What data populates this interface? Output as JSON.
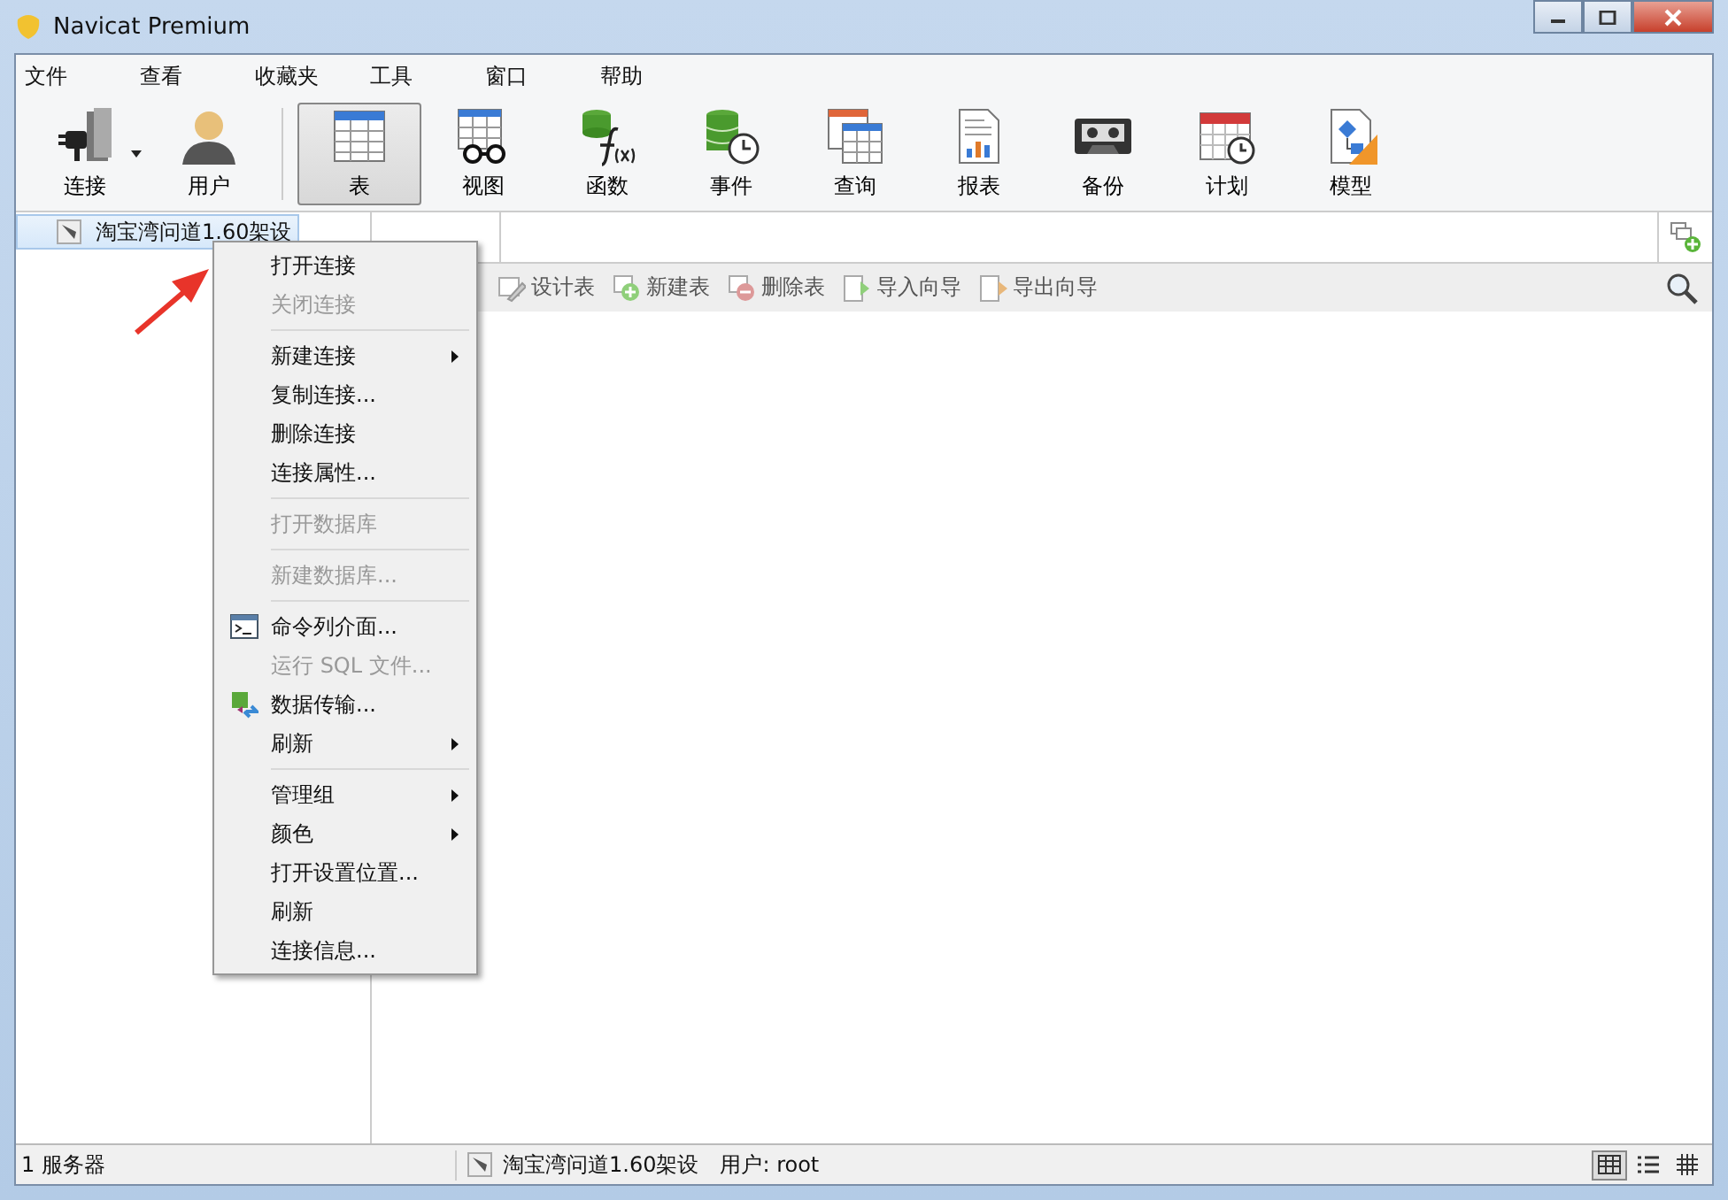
{
  "window": {
    "title": "Navicat Premium"
  },
  "menu_bar": [
    "文件",
    "查看",
    "收藏夹",
    "工具",
    "窗口",
    "帮助"
  ],
  "toolbar": [
    {
      "label": "连接",
      "kind": "connection",
      "dropdown": true,
      "selected": false
    },
    {
      "label": "用户",
      "kind": "user",
      "dropdown": false,
      "selected": false
    },
    {
      "label": "表",
      "kind": "table",
      "dropdown": false,
      "selected": true
    },
    {
      "label": "视图",
      "kind": "view",
      "dropdown": false,
      "selected": false
    },
    {
      "label": "函数",
      "kind": "function",
      "dropdown": false,
      "selected": false
    },
    {
      "label": "事件",
      "kind": "event",
      "dropdown": false,
      "selected": false
    },
    {
      "label": "查询",
      "kind": "query",
      "dropdown": false,
      "selected": false
    },
    {
      "label": "报表",
      "kind": "report",
      "dropdown": false,
      "selected": false
    },
    {
      "label": "备份",
      "kind": "backup",
      "dropdown": false,
      "selected": false
    },
    {
      "label": "计划",
      "kind": "schedule",
      "dropdown": false,
      "selected": false
    },
    {
      "label": "模型",
      "kind": "model",
      "dropdown": false,
      "selected": false
    }
  ],
  "tree": {
    "items": [
      {
        "label": "淘宝湾问道1.60架设",
        "selected": true
      }
    ]
  },
  "object_toolbar": [
    {
      "label": "设计表",
      "kind": "design"
    },
    {
      "label": "新建表",
      "kind": "new"
    },
    {
      "label": "删除表",
      "kind": "delete"
    },
    {
      "label": "导入向导",
      "kind": "import"
    },
    {
      "label": "导出向导",
      "kind": "export"
    }
  ],
  "context_menu": [
    {
      "kind": "plain",
      "label": "打开连接",
      "disabled": false,
      "submenu": false
    },
    {
      "kind": "plain",
      "label": "关闭连接",
      "disabled": true,
      "submenu": false
    },
    {
      "kind": "separator"
    },
    {
      "kind": "plain",
      "label": "新建连接",
      "disabled": false,
      "submenu": true
    },
    {
      "kind": "plain",
      "label": "复制连接...",
      "disabled": false,
      "submenu": false
    },
    {
      "kind": "plain",
      "label": "删除连接",
      "disabled": false,
      "submenu": false
    },
    {
      "kind": "plain",
      "label": "连接属性...",
      "disabled": false,
      "submenu": false
    },
    {
      "kind": "separator"
    },
    {
      "kind": "plain",
      "label": "打开数据库",
      "disabled": true,
      "submenu": false
    },
    {
      "kind": "separator"
    },
    {
      "kind": "plain",
      "label": "新建数据库...",
      "disabled": true,
      "submenu": false
    },
    {
      "kind": "separator"
    },
    {
      "kind": "console",
      "label": "命令列介面...",
      "disabled": false,
      "submenu": false
    },
    {
      "kind": "plain",
      "label": "运行 SQL 文件...",
      "disabled": true,
      "submenu": false
    },
    {
      "kind": "transfer",
      "label": "数据传输...",
      "disabled": false,
      "submenu": false
    },
    {
      "kind": "plain",
      "label": "刷新",
      "disabled": false,
      "submenu": true
    },
    {
      "kind": "separator"
    },
    {
      "kind": "plain",
      "label": "管理组",
      "disabled": false,
      "submenu": true
    },
    {
      "kind": "plain",
      "label": "颜色",
      "disabled": false,
      "submenu": true
    },
    {
      "kind": "plain",
      "label": "打开设置位置...",
      "disabled": false,
      "submenu": false
    },
    {
      "kind": "plain",
      "label": "刷新",
      "disabled": false,
      "submenu": false
    },
    {
      "kind": "plain",
      "label": "连接信息...",
      "disabled": false,
      "submenu": false
    }
  ],
  "status_bar": {
    "count": "1 服务器",
    "connection": "淘宝湾问道1.60架设",
    "user": "用户: root",
    "views": [
      {
        "kind": "icons",
        "selected": true
      },
      {
        "kind": "list",
        "selected": false
      },
      {
        "kind": "detail",
        "selected": false
      }
    ]
  }
}
